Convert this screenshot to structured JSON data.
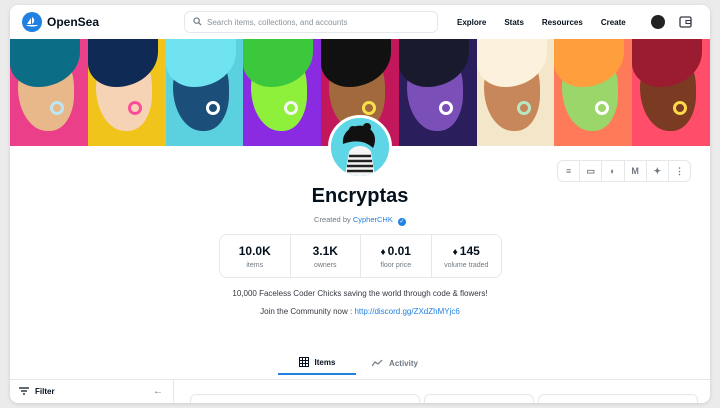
{
  "header": {
    "brand": "OpenSea",
    "search_placeholder": "Search items, collections, and accounts",
    "nav": [
      "Explore",
      "Stats",
      "Resources",
      "Create"
    ]
  },
  "collection": {
    "title": "Encryptas",
    "created_by_prefix": "Created by",
    "creator": "CypherCHK",
    "description": "10,000 Faceless Coder Chicks saving the world through code & flowers!",
    "community_prefix": "Join the Community now :",
    "community_link": "http://discord.gg/ZXdZhMYjc6"
  },
  "stats": [
    {
      "value": "10.0K",
      "label": "items",
      "eth": false
    },
    {
      "value": "3.1K",
      "label": "owners",
      "eth": false
    },
    {
      "value": "0.01",
      "label": "floor price",
      "eth": true
    },
    {
      "value": "145",
      "label": "volume traded",
      "eth": true
    }
  ],
  "social_icons": [
    "activity-icon",
    "website-icon",
    "discord-icon",
    "medium-icon",
    "twitter-icon",
    "more-icon"
  ],
  "social_glyphs": [
    "≡",
    "▭",
    "◐",
    "M",
    "✦",
    "⋮"
  ],
  "tabs": [
    {
      "label": "Items",
      "active": true
    },
    {
      "label": "Activity",
      "active": false
    }
  ],
  "filter": {
    "label": "Filter"
  },
  "colors": {
    "accent": "#2081e2",
    "text": "#04111d",
    "muted": "#707a83"
  }
}
